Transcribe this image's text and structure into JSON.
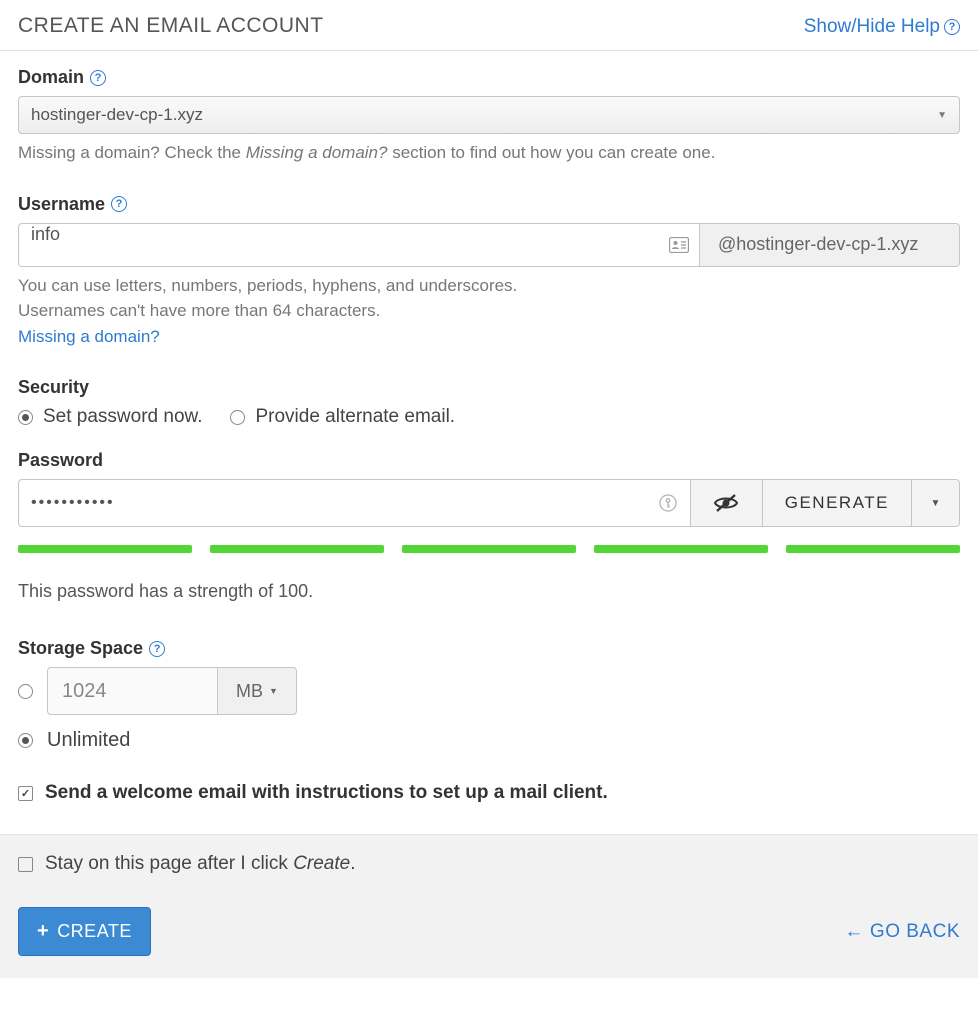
{
  "header": {
    "title": "CREATE AN EMAIL ACCOUNT",
    "help_link": "Show/Hide Help"
  },
  "domain": {
    "label": "Domain",
    "selected": "hostinger-dev-cp-1.xyz",
    "hint_prefix": "Missing a domain? Check the ",
    "hint_em": "Missing a domain?",
    "hint_suffix": " section to find out how you can create one."
  },
  "username": {
    "label": "Username",
    "value": "info",
    "addon": "@hostinger-dev-cp-1.xyz",
    "hint_line1": "You can use letters, numbers, periods, hyphens, and underscores.",
    "hint_line2": "Usernames can't have more than 64 characters.",
    "missing_link": "Missing a domain?"
  },
  "security": {
    "label": "Security",
    "options": {
      "set_now": "Set password now.",
      "alt_email": "Provide alternate email."
    },
    "selected": "set_now"
  },
  "password": {
    "label": "Password",
    "masked": "•••••••••••",
    "generate_label": "GENERATE",
    "strength_text": "This password has a strength of 100.",
    "strength_value": 100,
    "segments": 5
  },
  "storage": {
    "label": "Storage Space",
    "custom_value": "1024",
    "unit": "MB",
    "unlimited_label": "Unlimited",
    "selected": "unlimited"
  },
  "welcome": {
    "label": "Send a welcome email with instructions to set up a mail client.",
    "checked": true
  },
  "stay": {
    "prefix": "Stay on this page after I click ",
    "em": "Create",
    "suffix": ".",
    "checked": false
  },
  "actions": {
    "create": "CREATE",
    "go_back": "GO BACK"
  }
}
